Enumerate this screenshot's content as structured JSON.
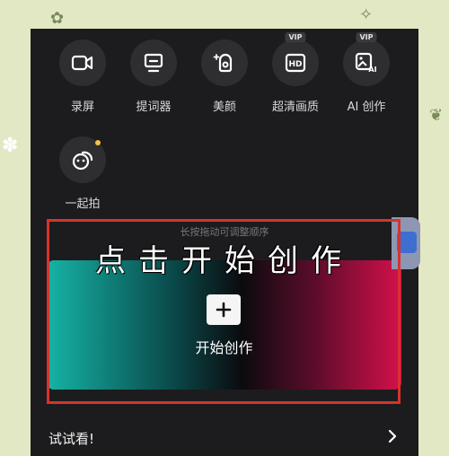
{
  "hint_text": "长按拖动可调整顺序",
  "tools": [
    {
      "label": "录屏",
      "icon": "video-camera-icon",
      "vip": ""
    },
    {
      "label": "提词器",
      "icon": "teleprompter-icon",
      "vip": ""
    },
    {
      "label": "美颜",
      "icon": "beauty-face-icon",
      "vip": ""
    },
    {
      "label": "超清画质",
      "icon": "hd-icon",
      "vip": "VIP"
    },
    {
      "label": "AI 创作",
      "icon": "ai-image-icon",
      "vip": "VIP"
    },
    {
      "label": "一起拍",
      "icon": "duet-icon",
      "vip": ""
    }
  ],
  "start_button": {
    "label": "开始创作"
  },
  "overlay_caption": "点击开始创作",
  "try_section": {
    "label": "试试看!"
  },
  "colors": {
    "accent_red": "#d8322c",
    "panel_bg": "#1c1c1e",
    "gradient_left": "#16b3a5",
    "gradient_right": "#d4104a",
    "notify_dot": "#f5c242"
  }
}
